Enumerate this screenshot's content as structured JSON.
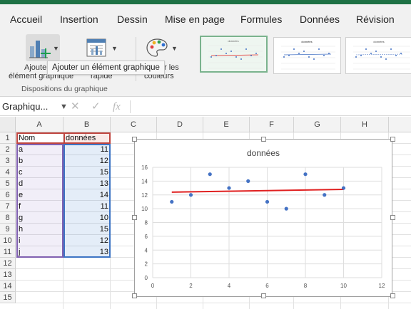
{
  "tabs": [
    "Accueil",
    "Insertion",
    "Dessin",
    "Mise en page",
    "Formules",
    "Données",
    "Révision"
  ],
  "ribbon": {
    "add_chart_element": {
      "line1": "Ajouter un",
      "line2": "élément graphique"
    },
    "quick_layout": {
      "line2": "rapide"
    },
    "change_colors": {
      "line1": "r les",
      "line2": "couleurs"
    },
    "group_label": "Dispositions du graphique",
    "tooltip": "Ajouter un élément graphique",
    "thumb_title": "données"
  },
  "formula_bar": {
    "name_box": "Graphiqu...",
    "fx": "fx"
  },
  "columns": [
    "A",
    "B",
    "C",
    "D",
    "E",
    "F",
    "G",
    "H"
  ],
  "rows": [
    "1",
    "2",
    "3",
    "4",
    "5",
    "6",
    "7",
    "8",
    "9",
    "10",
    "11",
    "12",
    "13",
    "14",
    "15"
  ],
  "table": {
    "headers": [
      "Nom",
      "données"
    ],
    "rows": [
      [
        "a",
        "11"
      ],
      [
        "b",
        "12"
      ],
      [
        "c",
        "15"
      ],
      [
        "d",
        "13"
      ],
      [
        "e",
        "14"
      ],
      [
        "f",
        "11"
      ],
      [
        "g",
        "10"
      ],
      [
        "h",
        "15"
      ],
      [
        "i",
        "12"
      ],
      [
        "j",
        "13"
      ]
    ]
  },
  "colors": {
    "accent": "#1e7145",
    "point": "#4472c4",
    "trendline": "#e02020"
  },
  "chart_data": {
    "type": "scatter",
    "title": "données",
    "x": [
      1,
      2,
      3,
      4,
      5,
      6,
      7,
      8,
      9,
      10
    ],
    "y": [
      11,
      12,
      15,
      13,
      14,
      11,
      10,
      15,
      12,
      13
    ],
    "trendline": {
      "x": [
        1,
        10
      ],
      "y": [
        12.4,
        12.8
      ]
    },
    "xlim": [
      0,
      12
    ],
    "ylim": [
      0,
      16
    ],
    "xticks": [
      "0",
      "2",
      "4",
      "6",
      "8",
      "10",
      "12"
    ],
    "yticks": [
      "0",
      "2",
      "4",
      "6",
      "8",
      "10",
      "12",
      "14",
      "16"
    ],
    "grid": true
  }
}
